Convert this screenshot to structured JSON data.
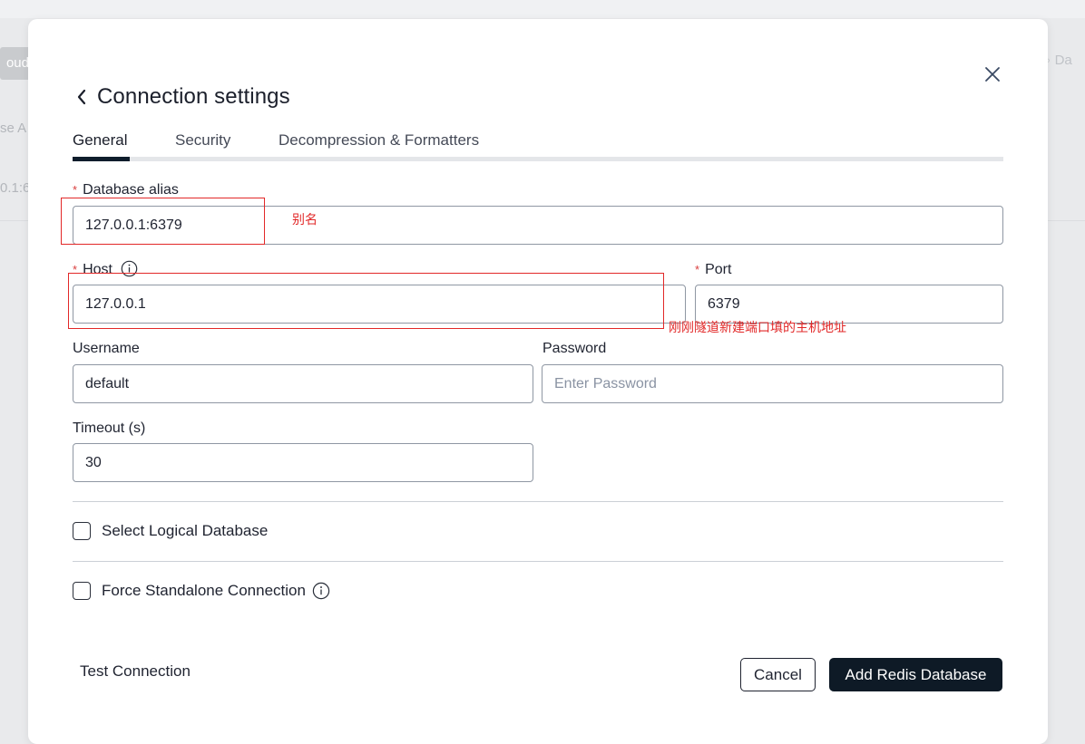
{
  "background": {
    "chip_text": "oud",
    "text_1": "se A",
    "text_2": "0.1:6",
    "search_hint": "Da"
  },
  "modal": {
    "title": "Connection settings",
    "tabs": [
      {
        "label": "General",
        "active": true
      },
      {
        "label": "Security",
        "active": false
      },
      {
        "label": "Decompression & Formatters",
        "active": false
      }
    ],
    "required_mark": "*",
    "fields": {
      "alias": {
        "label": "Database alias",
        "value": "127.0.0.1:6379"
      },
      "host": {
        "label": "Host",
        "value": "127.0.0.1"
      },
      "port": {
        "label": "Port",
        "value": "6379"
      },
      "username": {
        "label": "Username",
        "value": "default"
      },
      "password": {
        "label": "Password",
        "value": "",
        "placeholder": "Enter Password"
      },
      "timeout": {
        "label": "Timeout (s)",
        "value": "30"
      }
    },
    "checkboxes": {
      "logical_db": {
        "label": "Select Logical Database",
        "checked": false
      },
      "standalone": {
        "label": "Force Standalone Connection",
        "checked": false
      }
    },
    "buttons": {
      "test": "Test Connection",
      "cancel": "Cancel",
      "add": "Add Redis Database"
    }
  },
  "annotations": {
    "alias_note": "别名",
    "host_note": "刚刚隧道新建端口填的主机地址",
    "color": "#e22828"
  },
  "colors": {
    "primary_button": "#0e1a26",
    "required": "#d93d3d",
    "field_border": "#8f97a3"
  }
}
